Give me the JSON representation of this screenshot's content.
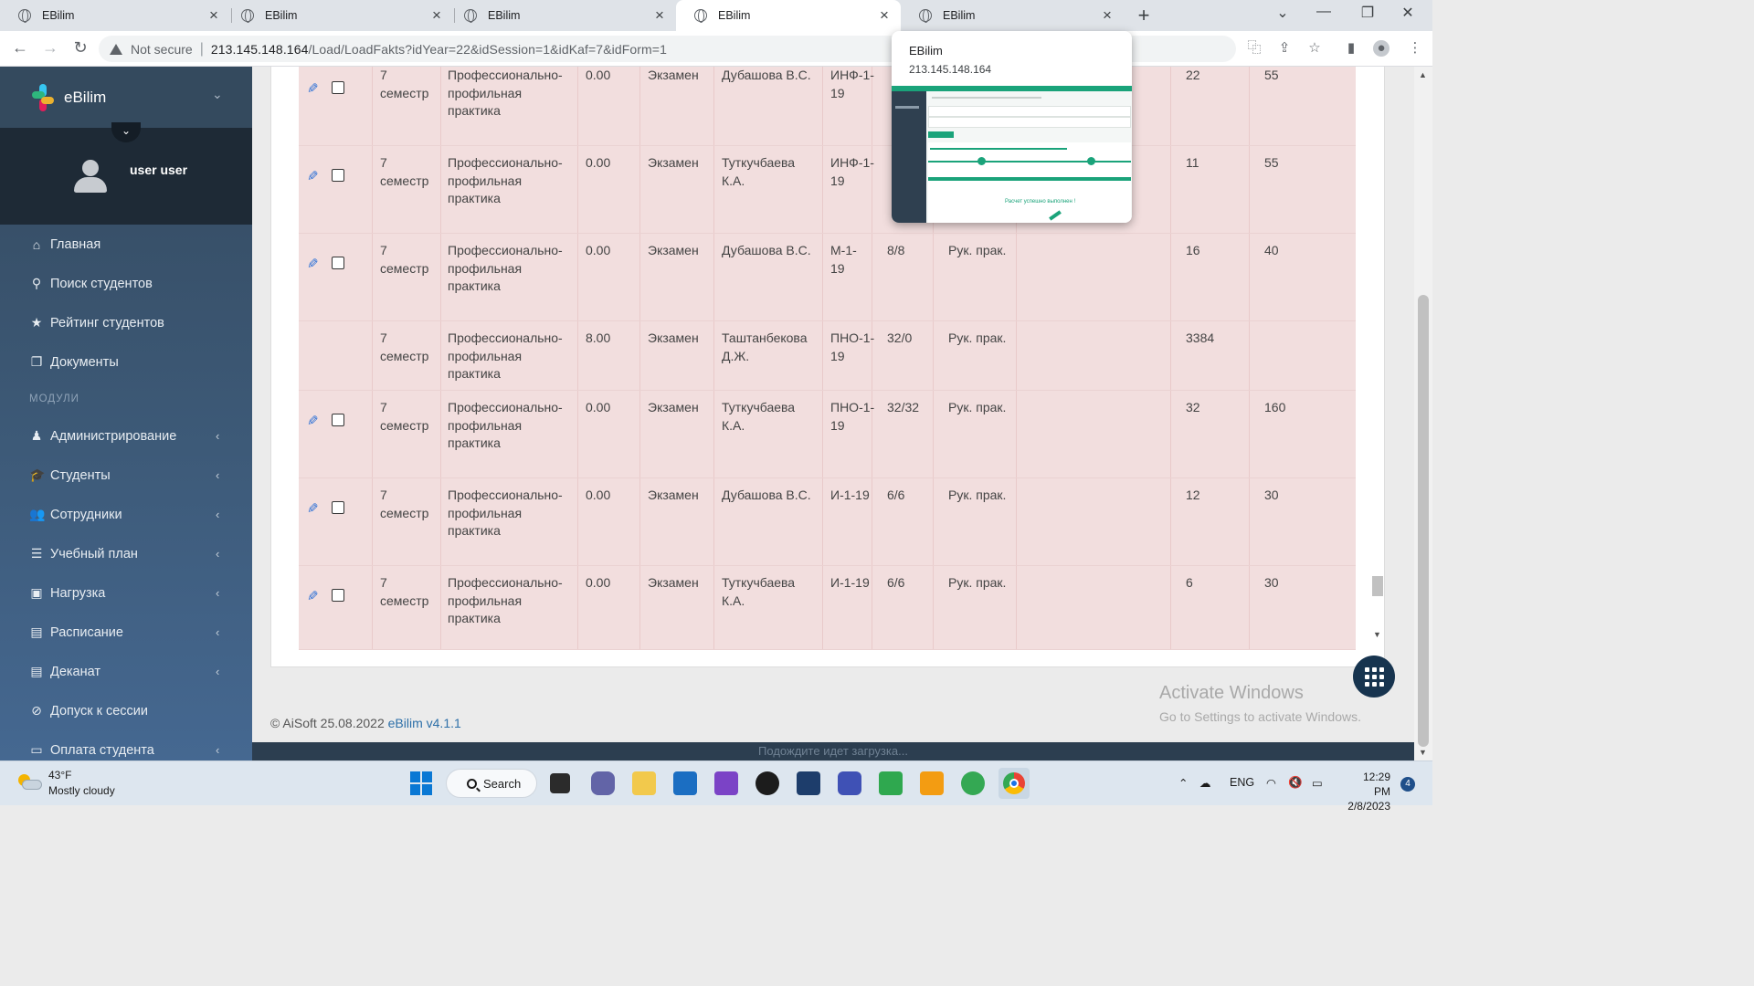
{
  "browser": {
    "tabs": [
      {
        "title": "EBilim",
        "active": false
      },
      {
        "title": "EBilim",
        "active": false
      },
      {
        "title": "EBilim",
        "active": false
      },
      {
        "title": "EBilim",
        "active": true
      },
      {
        "title": "EBilim",
        "active": false
      }
    ],
    "security_label": "Not secure",
    "url_host": "213.145.148.164",
    "url_path": "/Load/LoadFakts?idYear=22&idSession=1&idKaf=7&idForm=1",
    "tab_preview": {
      "title": "EBilim",
      "host": "213.145.148.164",
      "thumbnail_caption": "Расчет успешно выполнен !"
    }
  },
  "sidebar": {
    "brand": "eBilim",
    "user_name": "user user",
    "items": [
      {
        "label": "Главная",
        "icon": "home-icon",
        "glyph": "⌂",
        "has_children": false
      },
      {
        "label": "Поиск студентов",
        "icon": "search-icon",
        "glyph": "⚲",
        "has_children": false
      },
      {
        "label": "Рейтинг студентов",
        "icon": "star-icon",
        "glyph": "★",
        "has_children": false
      },
      {
        "label": "Документы",
        "icon": "documents-icon",
        "glyph": "❐",
        "has_children": false
      }
    ],
    "modules_header": "МОДУЛИ",
    "modules": [
      {
        "label": "Администрирование",
        "icon": "user-icon",
        "glyph": "♟",
        "has_children": true
      },
      {
        "label": "Студенты",
        "icon": "graduation-cap-icon",
        "glyph": "🎓",
        "has_children": true
      },
      {
        "label": "Сотрудники",
        "icon": "users-icon",
        "glyph": "👥",
        "has_children": true
      },
      {
        "label": "Учебный план",
        "icon": "list-icon",
        "glyph": "☰",
        "has_children": true
      },
      {
        "label": "Нагрузка",
        "icon": "id-card-icon",
        "glyph": "▣",
        "has_children": true
      },
      {
        "label": "Расписание",
        "icon": "book-icon",
        "glyph": "▤",
        "has_children": true
      },
      {
        "label": "Деканат",
        "icon": "book-open-icon",
        "glyph": "▤",
        "has_children": true
      },
      {
        "label": "Допуск к сессии",
        "icon": "ban-icon",
        "glyph": "⊘",
        "has_children": false
      },
      {
        "label": "Оплата студента",
        "icon": "money-icon",
        "glyph": "▭",
        "has_children": true
      }
    ]
  },
  "table": {
    "rows": [
      {
        "editable": true,
        "semester": "7 семестр",
        "discipline": "Профессионально-профильная практика",
        "credits": "0.00",
        "control": "Экзамен",
        "teacher": "Дубашова В.С.",
        "group": "ИНФ-1-19",
        "students": "",
        "type": "",
        "hours": "22",
        "total": "55"
      },
      {
        "editable": true,
        "semester": "7 семестр",
        "discipline": "Профессионально-профильная практика",
        "credits": "0.00",
        "control": "Экзамен",
        "teacher": "Туткучбаева К.А.",
        "group": "ИНФ-1-19",
        "students": "",
        "type": "",
        "hours": "11",
        "total": "55"
      },
      {
        "editable": true,
        "semester": "7 семестр",
        "discipline": "Профессионально-профильная практика",
        "credits": "0.00",
        "control": "Экзамен",
        "teacher": "Дубашова В.С.",
        "group": "М-1-19",
        "students": "8/8",
        "type": "Рук. прак.",
        "hours": "16",
        "total": "40"
      },
      {
        "editable": false,
        "semester": "7 семестр",
        "discipline": "Профессионально-профильная практика",
        "credits": "8.00",
        "control": "Экзамен",
        "teacher": "Таштанбекова Д.Ж.",
        "group": "ПНО-1-19",
        "students": "32/0",
        "type": "Рук. прак.",
        "hours": "3384",
        "total": ""
      },
      {
        "editable": true,
        "semester": "7 семестр",
        "discipline": "Профессионально-профильная практика",
        "credits": "0.00",
        "control": "Экзамен",
        "teacher": "Туткучбаева К.А.",
        "group": "ПНО-1-19",
        "students": "32/32",
        "type": "Рук. прак.",
        "hours": "32",
        "total": "160"
      },
      {
        "editable": true,
        "semester": "7 семестр",
        "discipline": "Профессионально-профильная практика",
        "credits": "0.00",
        "control": "Экзамен",
        "teacher": "Дубашова В.С.",
        "group": "И-1-19",
        "students": "6/6",
        "type": "Рук. прак.",
        "hours": "12",
        "total": "30"
      },
      {
        "editable": true,
        "semester": "7 семестр",
        "discipline": "Профессионально-профильная практика",
        "credits": "0.00",
        "control": "Экзамен",
        "teacher": "Туткучбаева К.А.",
        "group": "И-1-19",
        "students": "6/6",
        "type": "Рук. прак.",
        "hours": "6",
        "total": "30"
      }
    ]
  },
  "footer": {
    "copyright": "© AiSoft 25.08.2022",
    "version": "eBilim v4.1.1"
  },
  "status_bar": "Подождите идет загрузка...",
  "watermark": {
    "title": "Activate Windows",
    "subtitle": "Go to Settings to activate Windows."
  },
  "taskbar": {
    "weather_temp": "43°F",
    "weather_desc": "Mostly cloudy",
    "search_label": "Search",
    "language": "ENG",
    "time": "12:29 PM",
    "date": "2/8/2023",
    "notifications": "4"
  }
}
